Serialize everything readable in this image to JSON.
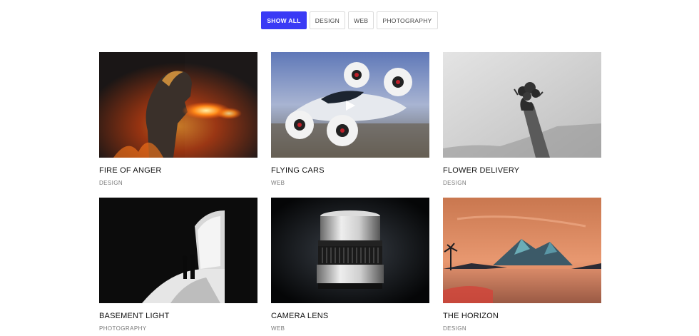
{
  "filters": [
    {
      "label": "SHOW ALL",
      "active": true
    },
    {
      "label": "DESIGN",
      "active": false
    },
    {
      "label": "WEB",
      "active": false
    },
    {
      "label": "PHOTOGRAPHY",
      "active": false
    }
  ],
  "accent_color": "#3a3af5",
  "items": [
    {
      "title": "FIRE OF ANGER",
      "category": "DESIGN",
      "image": "man-breathing-fire"
    },
    {
      "title": "FLYING CARS",
      "category": "WEB",
      "image": "flying-car-drone",
      "play_icon": "play-icon"
    },
    {
      "title": "FLOWER DELIVERY",
      "category": "DESIGN",
      "image": "hand-holding-flowers"
    },
    {
      "title": "BASEMENT LIGHT",
      "category": "PHOTOGRAPHY",
      "image": "two-people-in-light"
    },
    {
      "title": "CAMERA LENS",
      "category": "WEB",
      "image": "camera-lens"
    },
    {
      "title": "THE HORIZON",
      "category": "DESIGN",
      "image": "mountain-sunset"
    }
  ]
}
